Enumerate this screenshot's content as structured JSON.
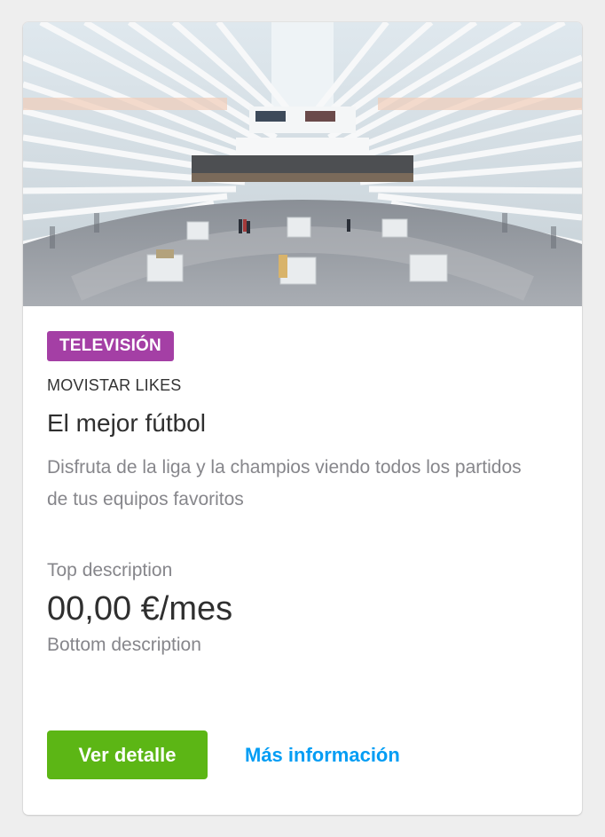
{
  "card": {
    "tag": "TELEVISIÓN",
    "overline": "MOVISTAR LIKES",
    "title": "El mejor fútbol",
    "description": "Disfruta de la liga y la champios viendo todos los partidos de tus equipos favoritos",
    "price_top": "Top description",
    "price": "00,00 €/mes",
    "price_bottom": "Bottom description",
    "primary_button": "Ver detalle",
    "secondary_link": "Más información"
  },
  "colors": {
    "tag_bg": "#a43fa5",
    "primary_button_bg": "#5cb615",
    "link": "#019df4"
  }
}
